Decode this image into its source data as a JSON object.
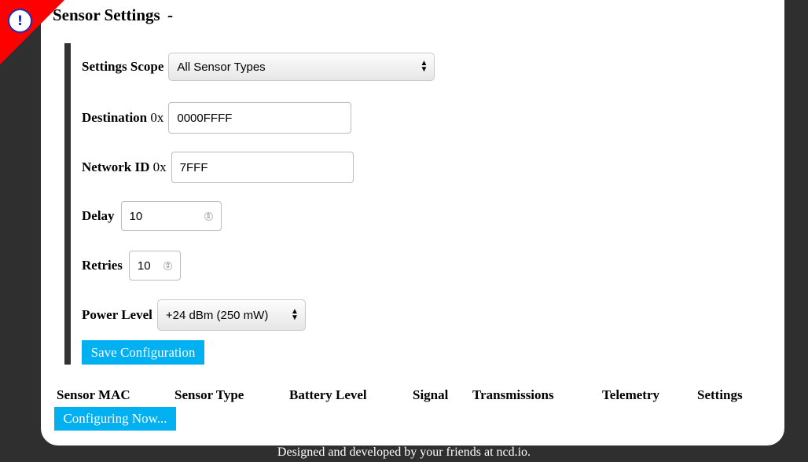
{
  "panel": {
    "title": "Sensor Settings",
    "title_suffix": "-",
    "alert_icon": "exclamation-icon",
    "alert_glyph": "!"
  },
  "form": {
    "settings_scope": {
      "label": "Settings Scope",
      "value": "All Sensor Types"
    },
    "destination": {
      "label": "Destination",
      "prefix": "0x",
      "value": "0000FFFF"
    },
    "network_id": {
      "label": "Network ID",
      "prefix": "0x",
      "value": "7FFF"
    },
    "delay": {
      "label": "Delay",
      "value": "10"
    },
    "retries": {
      "label": "Retries",
      "value": "10"
    },
    "power_level": {
      "label": "Power Level",
      "value": "+24 dBm (250 mW)"
    },
    "save_button": "Save Configuration"
  },
  "table": {
    "headers": [
      "Sensor MAC",
      "Sensor Type",
      "Battery Level",
      "Signal",
      "Transmissions",
      "Telemetry",
      "Settings"
    ]
  },
  "status_button": "Configuring Now...",
  "footer": "Designed and developed by your friends at ncd.io.",
  "colors": {
    "accent": "#00b0f0",
    "alert_corner": "#ff0000",
    "alert_icon": "#1e2fb8",
    "background": "#2f2f2f"
  }
}
